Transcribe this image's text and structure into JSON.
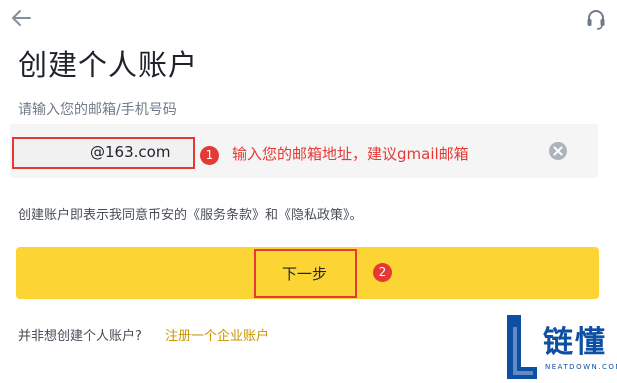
{
  "header": {
    "back_icon": "arrow-left-icon",
    "support_icon": "headset-icon"
  },
  "page_title": "创建个人账户",
  "email_field": {
    "label": "请输入您的邮箱/手机号码",
    "value": "@163.com",
    "clear_icon": "clear-circle-icon"
  },
  "annotations": {
    "marker_1": "1",
    "marker_1_text": "输入您的邮箱地址，建议gmail邮箱",
    "marker_2": "2",
    "color": "#e53935"
  },
  "terms_text": "创建账户即表示我同意币安的《服务条款》和《隐私政策》。",
  "next_button": {
    "label": "下一步",
    "color": "#fcd535"
  },
  "footer": {
    "prefix": "并非想创建个人账户?",
    "link": "注册一个企业账户",
    "link_color": "#c99400"
  },
  "watermark": {
    "cn": "链懂",
    "en": "NEATDOWN.COM"
  }
}
